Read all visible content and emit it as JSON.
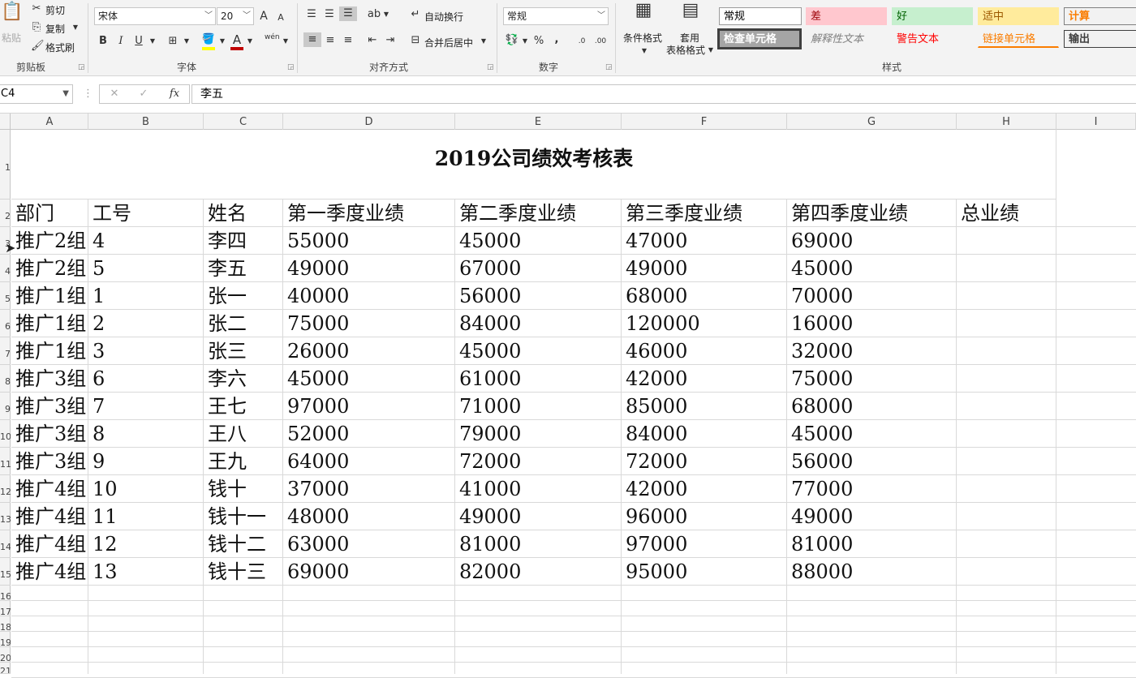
{
  "ribbon": {
    "clipboard": {
      "paste": "粘贴",
      "cut": "剪切",
      "copy": "复制",
      "format_painter": "格式刷",
      "group": "剪贴板"
    },
    "font": {
      "name": "宋体",
      "size": "20",
      "bold": "B",
      "italic": "I",
      "underline": "U",
      "grow": "A",
      "shrink": "A",
      "font_color_glyph": "A",
      "phonetic": "wén",
      "group": "字体"
    },
    "alignment": {
      "wrap": "自动换行",
      "merge": "合并后居中",
      "group": "对齐方式"
    },
    "number": {
      "format": "常规",
      "percent": "%",
      "comma": ",",
      "inc_decimal": ".0",
      "dec_decimal": ".00",
      "group": "数字"
    },
    "styles": {
      "conditional": "条件格式",
      "table_top": "套用",
      "table_bottom": "表格格式",
      "group": "样式",
      "boxes": [
        {
          "label": "常规",
          "bg": "#ffffff",
          "color": "#000000",
          "border": "#9b9b9b"
        },
        {
          "label": "差",
          "bg": "#ffc7ce",
          "color": "#9c0006",
          "border": "#ffc7ce"
        },
        {
          "label": "好",
          "bg": "#c6efce",
          "color": "#006100",
          "border": "#c6efce"
        },
        {
          "label": "适中",
          "bg": "#ffeb9c",
          "color": "#9c5700",
          "border": "#ffeb9c"
        },
        {
          "label": "计算",
          "bg": "#f2f2f2",
          "color": "#fa7d00",
          "border": "#7f7f7f"
        },
        {
          "label": "检查单元格",
          "bg": "#a5a5a5",
          "color": "#ffffff",
          "border": "#3f3f3f"
        },
        {
          "label": "解释性文本",
          "bg": "#f3f3f3",
          "color": "#7f7f7f",
          "border": "#f3f3f3"
        },
        {
          "label": "警告文本",
          "bg": "#f3f3f3",
          "color": "#ff0000",
          "border": "#f3f3f3"
        },
        {
          "label": "链接单元格",
          "bg": "#f3f3f3",
          "color": "#fa7d00",
          "border": "#f3f3f3"
        },
        {
          "label": "输出",
          "bg": "#f2f2f2",
          "color": "#3f3f3f",
          "border": "#3f3f3f"
        }
      ]
    }
  },
  "formula_bar": {
    "name_box": "C4",
    "fx": "fx",
    "value": "李五"
  },
  "columns": [
    "A",
    "B",
    "C",
    "D",
    "E",
    "F",
    "G",
    "H",
    "I"
  ],
  "rows": [
    "1",
    "2",
    "3",
    "4",
    "5",
    "6",
    "7",
    "8",
    "9",
    "10",
    "11",
    "12",
    "13",
    "14",
    "15",
    "16",
    "17",
    "18",
    "19",
    "20",
    "21"
  ],
  "sheet": {
    "title": "2019公司绩效考核表",
    "headers": [
      "部门",
      "工号",
      "姓名",
      "第一季度业绩",
      "第二季度业绩",
      "第三季度业绩",
      "第四季度业绩",
      "总业绩"
    ],
    "data": [
      [
        "推广2组",
        "4",
        "李四",
        "55000",
        "45000",
        "47000",
        "69000",
        ""
      ],
      [
        "推广2组",
        "5",
        "李五",
        "49000",
        "67000",
        "49000",
        "45000",
        ""
      ],
      [
        "推广1组",
        "1",
        "张一",
        "40000",
        "56000",
        "68000",
        "70000",
        ""
      ],
      [
        "推广1组",
        "2",
        "张二",
        "75000",
        "84000",
        "120000",
        "16000",
        ""
      ],
      [
        "推广1组",
        "3",
        "张三",
        "26000",
        "45000",
        "46000",
        "32000",
        ""
      ],
      [
        "推广3组",
        "6",
        "李六",
        "45000",
        "61000",
        "42000",
        "75000",
        ""
      ],
      [
        "推广3组",
        "7",
        "王七",
        "97000",
        "71000",
        "85000",
        "68000",
        ""
      ],
      [
        "推广3组",
        "8",
        "王八",
        "52000",
        "79000",
        "84000",
        "45000",
        ""
      ],
      [
        "推广3组",
        "9",
        "王九",
        "64000",
        "72000",
        "72000",
        "56000",
        ""
      ],
      [
        "推广4组",
        "10",
        "钱十",
        "37000",
        "41000",
        "42000",
        "77000",
        ""
      ],
      [
        "推广4组",
        "11",
        "钱十一",
        "48000",
        "49000",
        "96000",
        "49000",
        ""
      ],
      [
        "推广4组",
        "12",
        "钱十二",
        "63000",
        "81000",
        "97000",
        "81000",
        ""
      ],
      [
        "推广4组",
        "13",
        "钱十三",
        "69000",
        "82000",
        "95000",
        "88000",
        ""
      ]
    ]
  }
}
